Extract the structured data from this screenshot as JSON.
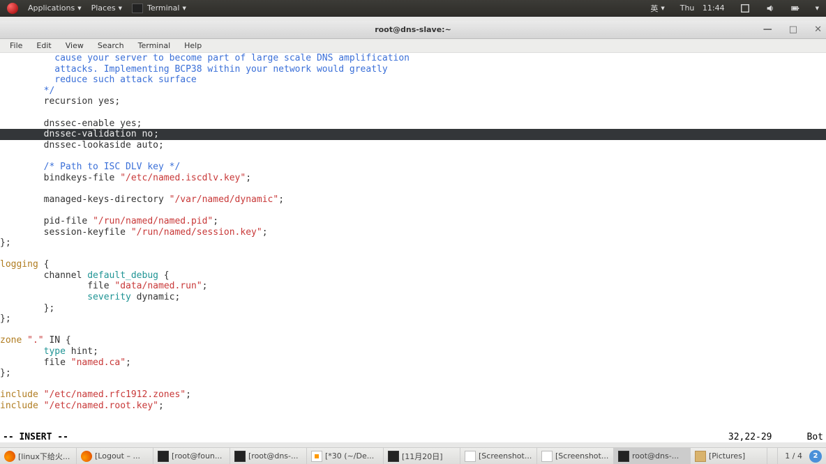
{
  "panel": {
    "applications": "Applications",
    "places": "Places",
    "terminal": "Terminal",
    "input": "英",
    "day": "Thu",
    "time": "11:44"
  },
  "window": {
    "title": "root@dns-slave:~"
  },
  "menubar": [
    "File",
    "Edit",
    "View",
    "Search",
    "Terminal",
    "Help"
  ],
  "editor": {
    "l1": "          cause your server to become part of large scale DNS amplification",
    "l2": "          attacks. Implementing BCP38 within your network would greatly",
    "l3": "          reduce such attack surface",
    "l4": "        */",
    "l5": "        recursion yes;",
    "l6": "",
    "l7": "        dnssec-enable yes;",
    "l8a": "        dnssec-validation n",
    "l8b": "o",
    "l8c": ";",
    "l9": "        dnssec-lookaside auto;",
    "l10": "",
    "l11": "        /* Path to ISC DLV key */",
    "l12a": "        bindkeys-file ",
    "l12b": "\"/etc/named.iscdlv.key\"",
    "l12c": ";",
    "l13": "",
    "l14a": "        managed-keys-directory ",
    "l14b": "\"/var/named/dynamic\"",
    "l14c": ";",
    "l15": "",
    "l16a": "        pid-file ",
    "l16b": "\"/run/named/named.pid\"",
    "l16c": ";",
    "l17a": "        session-keyfile ",
    "l17b": "\"/run/named/session.key\"",
    "l17c": ";",
    "l18": "};",
    "l19": "",
    "l20a": "logging",
    "l20b": " {",
    "l21a": "        channel ",
    "l21b": "default_debug",
    "l21c": " {",
    "l22a": "                file ",
    "l22b": "\"data/named.run\"",
    "l22c": ";",
    "l23a": "                ",
    "l23b": "severity",
    "l23c": " dynamic;",
    "l24": "        };",
    "l25": "};",
    "l26": "",
    "l27a": "zone ",
    "l27b": "\".\"",
    "l27c": " IN {",
    "l28a": "        ",
    "l28b": "type",
    "l28c": " hint;",
    "l29a": "        file ",
    "l29b": "\"named.ca\"",
    "l29c": ";",
    "l30": "};",
    "l31": "",
    "l32a": "include ",
    "l32b": "\"/etc/named.rfc1912.zones\"",
    "l32c": ";",
    "l33a": "include ",
    "l33b": "\"/etc/named.root.key\"",
    "l33c": ";"
  },
  "status": {
    "mode": "-- INSERT --",
    "pos": "32,22-29",
    "scroll": "Bot"
  },
  "tasks": [
    {
      "label": "[linux下给火...",
      "icon": "ff"
    },
    {
      "label": "[Logout – ...",
      "icon": "ff"
    },
    {
      "label": "[root@foun...",
      "icon": "tm"
    },
    {
      "label": "[root@dns-...",
      "icon": "tm"
    },
    {
      "label": "[*30 (~/De...",
      "icon": "ge"
    },
    {
      "label": "[11月20日]",
      "icon": "tm"
    },
    {
      "label": "[Screenshot...",
      "icon": "mg"
    },
    {
      "label": "[Screenshot...",
      "icon": "mg"
    },
    {
      "label": "root@dns-...",
      "icon": "tm",
      "active": true
    },
    {
      "label": "[Pictures]",
      "icon": "fo"
    }
  ],
  "tray": {
    "workspace": "1 / 4",
    "notif": "2"
  }
}
